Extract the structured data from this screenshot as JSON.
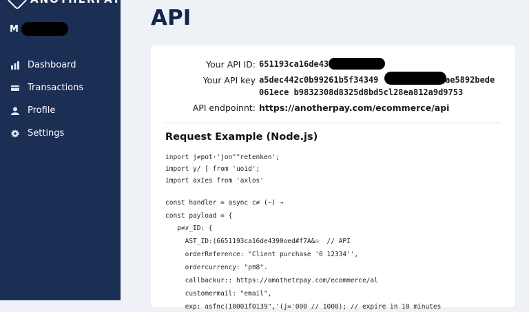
{
  "sidebar": {
    "brand_name": "ANOTHERPAY",
    "user_initial": "M",
    "nav": [
      {
        "label": "Dashboard",
        "icon": "bar-chart-icon"
      },
      {
        "label": "Transactions",
        "icon": "card-icon"
      },
      {
        "label": "Profile",
        "icon": "user-icon"
      },
      {
        "label": "Settings",
        "icon": "gear-icon"
      }
    ]
  },
  "main": {
    "title": "API",
    "api_id_label": "Your API ID:",
    "api_id_value": "651193ca16de43",
    "api_key_label": "Your API key",
    "api_key_line1": "a5dec442c0b99261b5f34349",
    "api_key_line1_suffix": "ae5892bede",
    "api_key_line2": "061ece b9832308d8325d8bd5cl28ea812a9d9753",
    "endpoint_label": "API endpoinnt:",
    "endpoint_value": "https://anotherpay.com/ecommerce/api",
    "request_title": "Request Example (Node.js)",
    "code_lines": [
      "inport j≠pot·'jon\"\"retenken';",
      "import y/ [ from 'uoid';",
      "import axIes from 'axlos'",
      "const handler = async c≠ (−) →",
      "const payload = {",
      "   p≠✗_ID: {",
      "     AST_ID:(6651193ca16de4390oed#f7A&☉  // API",
      "     orderReference: \"Client purchase '0 12334'',",
      "     ordercurrency: \"pπ8\".",
      "     callbackur:: https://amothetrpay.com/ecommerce/al",
      "     customermail: \"email\",",
      "     exp: asfnc(10001f0139\",'(j='000 // 1000); // expire in 10 minutes"
    ]
  }
}
